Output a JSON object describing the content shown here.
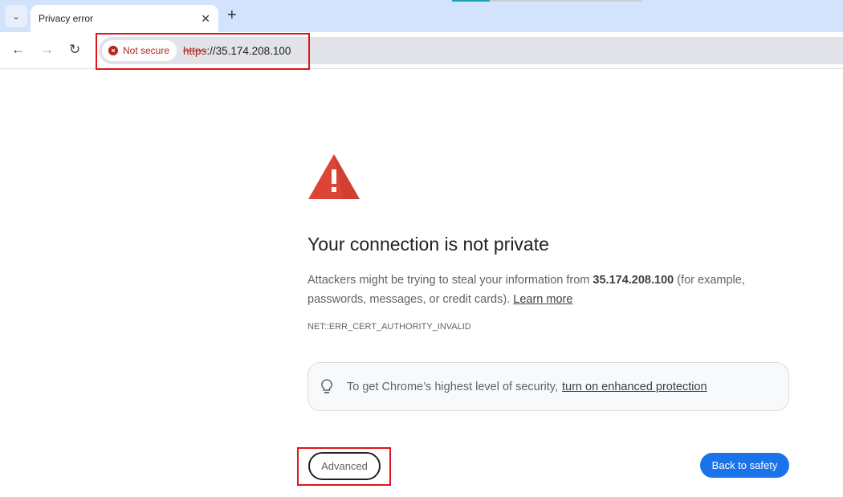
{
  "browser": {
    "tab_title": "Privacy error",
    "security_chip": "Not secure",
    "url_scheme": "https",
    "url_rest": "://35.174.208.100",
    "colors": {
      "tabstrip": "#d3e3fd",
      "danger": "#b3261e"
    }
  },
  "page": {
    "title": "Your connection is not private",
    "para_prefix": "Attackers might be trying to steal your information from ",
    "host": "35.174.208.100",
    "para_suffix": " (for example, passwords, messages, or credit cards). ",
    "learn_more": "Learn more",
    "error_code": "NET::ERR_CERT_AUTHORITY_INVALID",
    "info_text": "To get Chrome’s highest level of security,",
    "info_link": "turn on enhanced protection",
    "advanced_label": "Advanced",
    "back_label": "Back to safety",
    "colors": {
      "warning": "#db4437",
      "primary": "#1a73e8"
    }
  }
}
